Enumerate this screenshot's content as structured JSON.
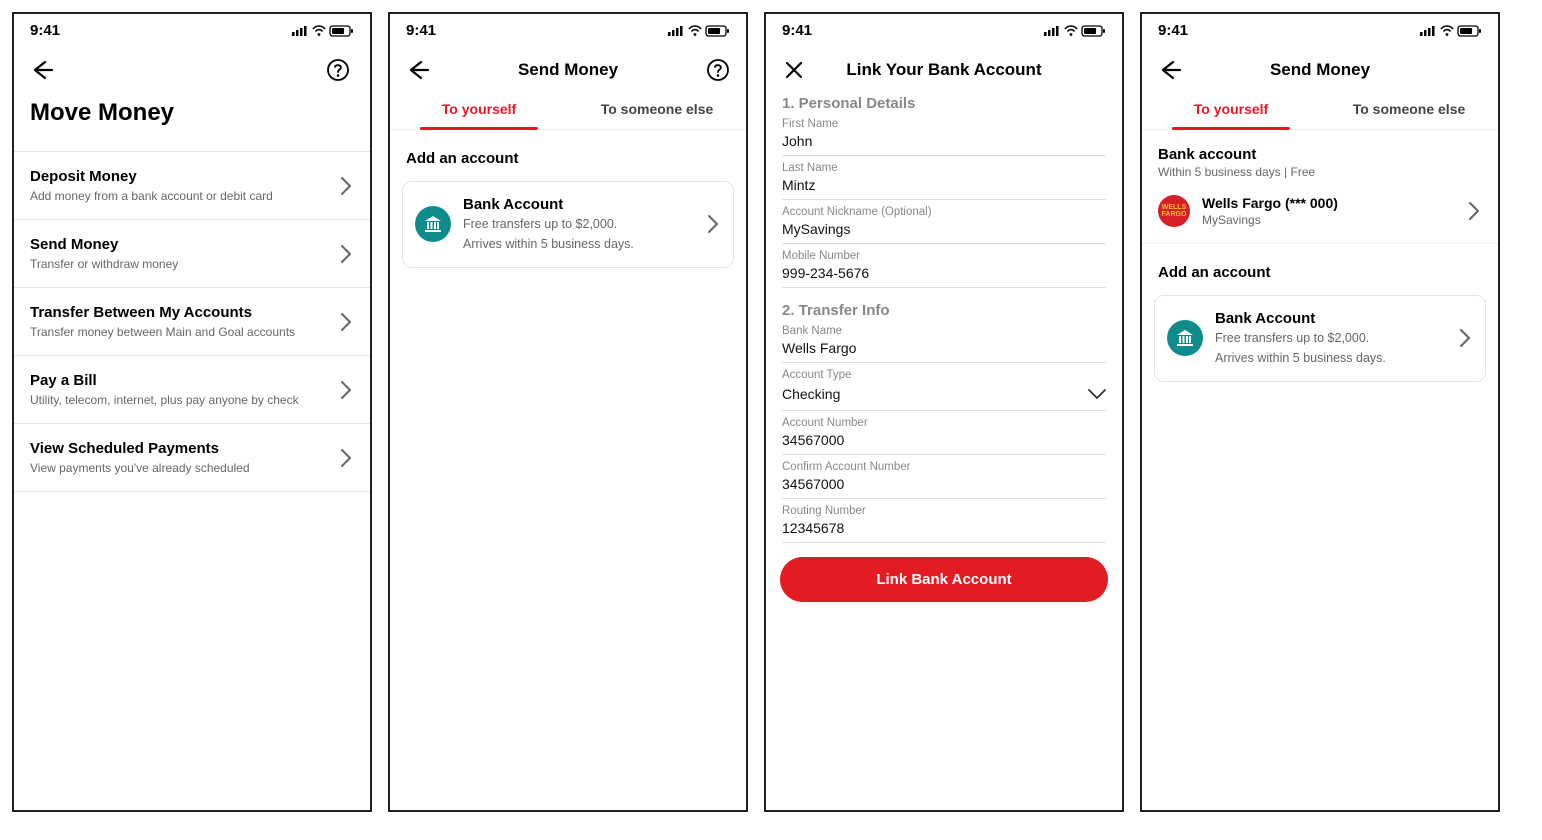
{
  "status_time": "9:41",
  "screen1": {
    "title": "Move Money",
    "items": [
      {
        "title": "Deposit Money",
        "sub": "Add money from a bank account or debit card"
      },
      {
        "title": "Send Money",
        "sub": "Transfer or withdraw  money"
      },
      {
        "title": "Transfer Between My Accounts",
        "sub": "Transfer money between Main and Goal accounts"
      },
      {
        "title": "Pay a Bill",
        "sub": "Utility, telecom, internet,  plus pay anyone by check"
      },
      {
        "title": "View Scheduled Payments",
        "sub": "View payments you've already scheduled"
      }
    ]
  },
  "screen2": {
    "title": "Send Money",
    "tabs": {
      "a": "To yourself",
      "b": "To someone else"
    },
    "section": "Add an account",
    "card": {
      "title": "Bank Account",
      "line1": "Free transfers up to $2,000.",
      "line2": "Arrives within 5 business days."
    }
  },
  "screen3": {
    "title": "Link Your Bank Account",
    "section1": "1. Personal Details",
    "first_name_label": "First Name",
    "first_name": "John",
    "last_name_label": "Last Name",
    "last_name": "Mintz",
    "nickname_label": "Account Nickname (Optional)",
    "nickname": "MySavings",
    "mobile_label": "Mobile Number",
    "mobile": "999-234-5676",
    "section2": "2. Transfer Info",
    "bank_name_label": "Bank Name",
    "bank_name": "Wells Fargo",
    "account_type_label": "Account Type",
    "account_type": "Checking",
    "account_number_label": "Account Number",
    "account_number": "34567000",
    "confirm_label": "Confirm Account Number",
    "confirm": "34567000",
    "routing_label": "Routing Number",
    "routing": "12345678",
    "button": "Link Bank Account"
  },
  "screen4": {
    "title": "Send Money",
    "tabs": {
      "a": "To yourself",
      "b": "To someone else"
    },
    "bank_header": "Bank account",
    "bank_sub": "Within 5 business days | Free",
    "account": {
      "logo_text": "WELLS\nFARGO",
      "name": "Wells Fargo (*** 000)",
      "nick": "MySavings"
    },
    "add_section": "Add an account",
    "card": {
      "title": "Bank Account",
      "line1": "Free transfers up to $2,000.",
      "line2": "Arrives within 5 business days."
    }
  }
}
